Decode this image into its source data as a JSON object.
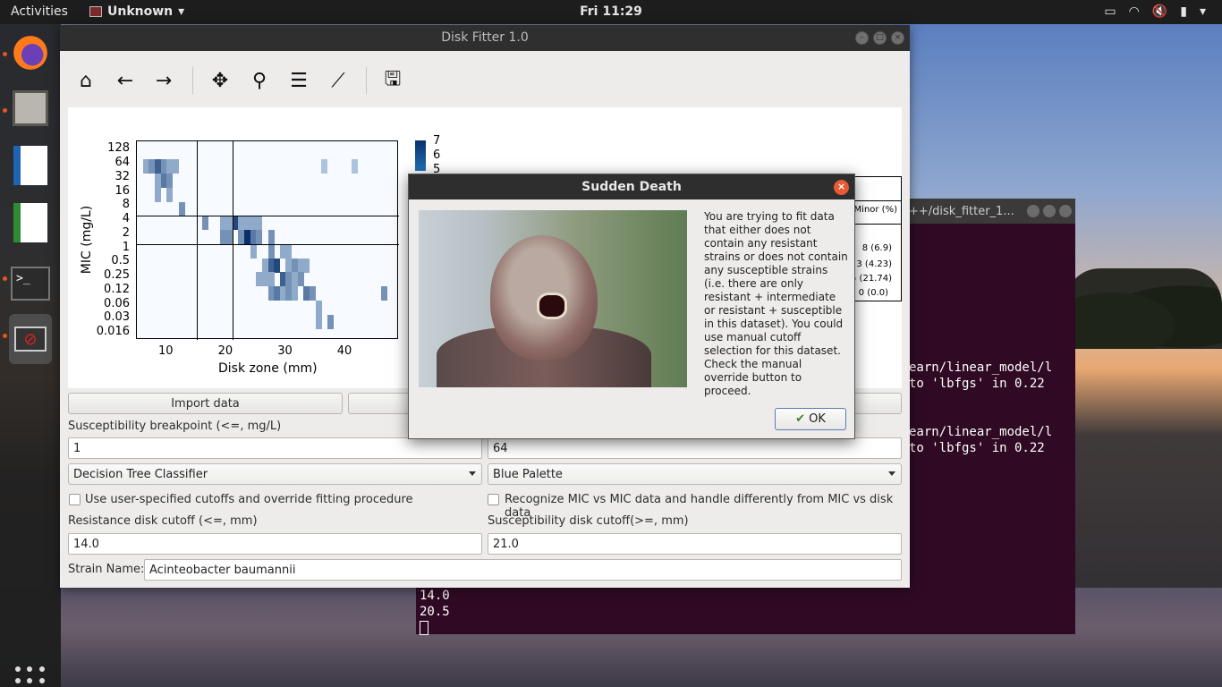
{
  "topbar": {
    "activities": "Activities",
    "app_menu": "Unknown",
    "clock": "Fri 11:29"
  },
  "dock": {
    "items": [
      "firefox",
      "files",
      "libreoffice-writer",
      "libreoffice-calc",
      "terminal",
      "disk-fitter"
    ]
  },
  "terminal": {
    "title": "++/disk_fitter_1...",
    "lines_upper": [
      "earn/linear_model/l",
      " to 'lbfgs' in 0.22",
      "",
      "",
      "earn/linear_model/l",
      " to 'lbfgs' in 0.22"
    ],
    "lines_lower": [
      "14.0",
      "20.5"
    ]
  },
  "window": {
    "title": "Disk Fitter 1.0"
  },
  "plot": {
    "ylabel": "MIC (mg/L)",
    "xlabel": "Disk zone (mm)",
    "yticks": [
      "128",
      "64",
      "32",
      "16",
      "8",
      "4",
      "2",
      "1",
      "0.5",
      "0.25",
      "0.12",
      "0.06",
      "0.03",
      "0.016"
    ],
    "xticks": [
      "10",
      "20",
      "30",
      "40"
    ],
    "colorbar_labels": [
      "7",
      "6",
      "5"
    ],
    "stats_header": "Minor (%)",
    "stats_values": [
      "8 (6.9)",
      "3 (4.23)",
      "5 (21.74)",
      "0 (0.0)"
    ]
  },
  "chart_data": {
    "type": "heatmap",
    "xlabel": "Disk zone (mm)",
    "ylabel": "MIC (mg/L)",
    "xlim": [
      5,
      49
    ],
    "y_categories": [
      "0.016",
      "0.03",
      "0.06",
      "0.12",
      "0.25",
      "0.5",
      "1",
      "2",
      "4",
      "8",
      "16",
      "32",
      "64",
      "128"
    ],
    "cells": [
      {
        "x": 6,
        "y": "64",
        "v": 2
      },
      {
        "x": 7,
        "y": "64",
        "v": 3
      },
      {
        "x": 8,
        "y": "64",
        "v": 5
      },
      {
        "x": 9,
        "y": "64",
        "v": 3
      },
      {
        "x": 10,
        "y": "64",
        "v": 2
      },
      {
        "x": 11,
        "y": "64",
        "v": 2
      },
      {
        "x": 36,
        "y": "64",
        "v": 1
      },
      {
        "x": 41,
        "y": "64",
        "v": 1
      },
      {
        "x": 8,
        "y": "32",
        "v": 2
      },
      {
        "x": 9,
        "y": "32",
        "v": 4
      },
      {
        "x": 10,
        "y": "32",
        "v": 3
      },
      {
        "x": 8,
        "y": "16",
        "v": 2
      },
      {
        "x": 10,
        "y": "16",
        "v": 2
      },
      {
        "x": 12,
        "y": "8",
        "v": 3
      },
      {
        "x": 16,
        "y": "4",
        "v": 3
      },
      {
        "x": 19,
        "y": "4",
        "v": 2
      },
      {
        "x": 20,
        "y": "4",
        "v": 2
      },
      {
        "x": 21,
        "y": "4",
        "v": 6
      },
      {
        "x": 22,
        "y": "4",
        "v": 2
      },
      {
        "x": 23,
        "y": "4",
        "v": 2
      },
      {
        "x": 24,
        "y": "4",
        "v": 2
      },
      {
        "x": 25,
        "y": "4",
        "v": 2
      },
      {
        "x": 19,
        "y": "2",
        "v": 3
      },
      {
        "x": 20,
        "y": "2",
        "v": 3
      },
      {
        "x": 22,
        "y": "2",
        "v": 3
      },
      {
        "x": 23,
        "y": "2",
        "v": 7
      },
      {
        "x": 24,
        "y": "2",
        "v": 4
      },
      {
        "x": 25,
        "y": "2",
        "v": 3
      },
      {
        "x": 27,
        "y": "2",
        "v": 3
      },
      {
        "x": 24,
        "y": "1",
        "v": 2
      },
      {
        "x": 27,
        "y": "1",
        "v": 3
      },
      {
        "x": 29,
        "y": "1",
        "v": 2
      },
      {
        "x": 30,
        "y": "1",
        "v": 2
      },
      {
        "x": 26,
        "y": "0.5",
        "v": 2
      },
      {
        "x": 27,
        "y": "0.5",
        "v": 5
      },
      {
        "x": 28,
        "y": "0.5",
        "v": 6
      },
      {
        "x": 30,
        "y": "0.5",
        "v": 2
      },
      {
        "x": 31,
        "y": "0.5",
        "v": 3
      },
      {
        "x": 32,
        "y": "0.5",
        "v": 2
      },
      {
        "x": 33,
        "y": "0.5",
        "v": 2
      },
      {
        "x": 25,
        "y": "0.25",
        "v": 2
      },
      {
        "x": 26,
        "y": "0.25",
        "v": 2
      },
      {
        "x": 27,
        "y": "0.25",
        "v": 2
      },
      {
        "x": 29,
        "y": "0.25",
        "v": 5
      },
      {
        "x": 30,
        "y": "0.25",
        "v": 3
      },
      {
        "x": 31,
        "y": "0.25",
        "v": 2
      },
      {
        "x": 32,
        "y": "0.25",
        "v": 3
      },
      {
        "x": 27,
        "y": "0.12",
        "v": 3
      },
      {
        "x": 28,
        "y": "0.12",
        "v": 4
      },
      {
        "x": 29,
        "y": "0.12",
        "v": 2
      },
      {
        "x": 30,
        "y": "0.12",
        "v": 3
      },
      {
        "x": 31,
        "y": "0.12",
        "v": 2
      },
      {
        "x": 33,
        "y": "0.12",
        "v": 4
      },
      {
        "x": 34,
        "y": "0.12",
        "v": 3
      },
      {
        "x": 46,
        "y": "0.12",
        "v": 3
      },
      {
        "x": 35,
        "y": "0.06",
        "v": 2
      },
      {
        "x": 35,
        "y": "0.03",
        "v": 2
      },
      {
        "x": 37,
        "y": "0.03",
        "v": 3
      }
    ],
    "vlines": [
      15,
      21
    ],
    "hlines": [
      "8",
      "2"
    ],
    "colorbar_range": [
      0,
      7
    ]
  },
  "form": {
    "import_button": "Import data",
    "susc_breakpoint_label": "Susceptibility breakpoint (<=, mg/L)",
    "susc_breakpoint_value": "1",
    "res_breakpoint_value": "64",
    "classifier_value": "Decision Tree Classifier",
    "palette_value": "Blue Palette",
    "override_label": "Use user-specified cutoffs and override fitting procedure",
    "mic_vs_mic_label": "Recognize MIC vs MIC data and handle differently from MIC vs disk data",
    "res_disk_label": "Resistance disk cutoff (<=, mm)",
    "res_disk_value": "14.0",
    "susc_disk_label": "Susceptibility disk cutoff(>=, mm)",
    "susc_disk_value": "21.0",
    "strain_label": "Strain Name:",
    "strain_value": "Acinteobacter baumannii"
  },
  "dialog": {
    "title": "Sudden Death",
    "message": "You are trying to fit data that either does not contain any resistant strains or does not contain any susceptible strains (i.e. there are only resistant + intermediate or resistant + susceptible in this dataset). You could use manual cutoff selection for this dataset. Check the manual override button to proceed.",
    "ok_label": "OK"
  },
  "colors": {
    "accent": "#e95420",
    "heat_dark": "#08306b",
    "heat_light": "#c6dbef"
  }
}
